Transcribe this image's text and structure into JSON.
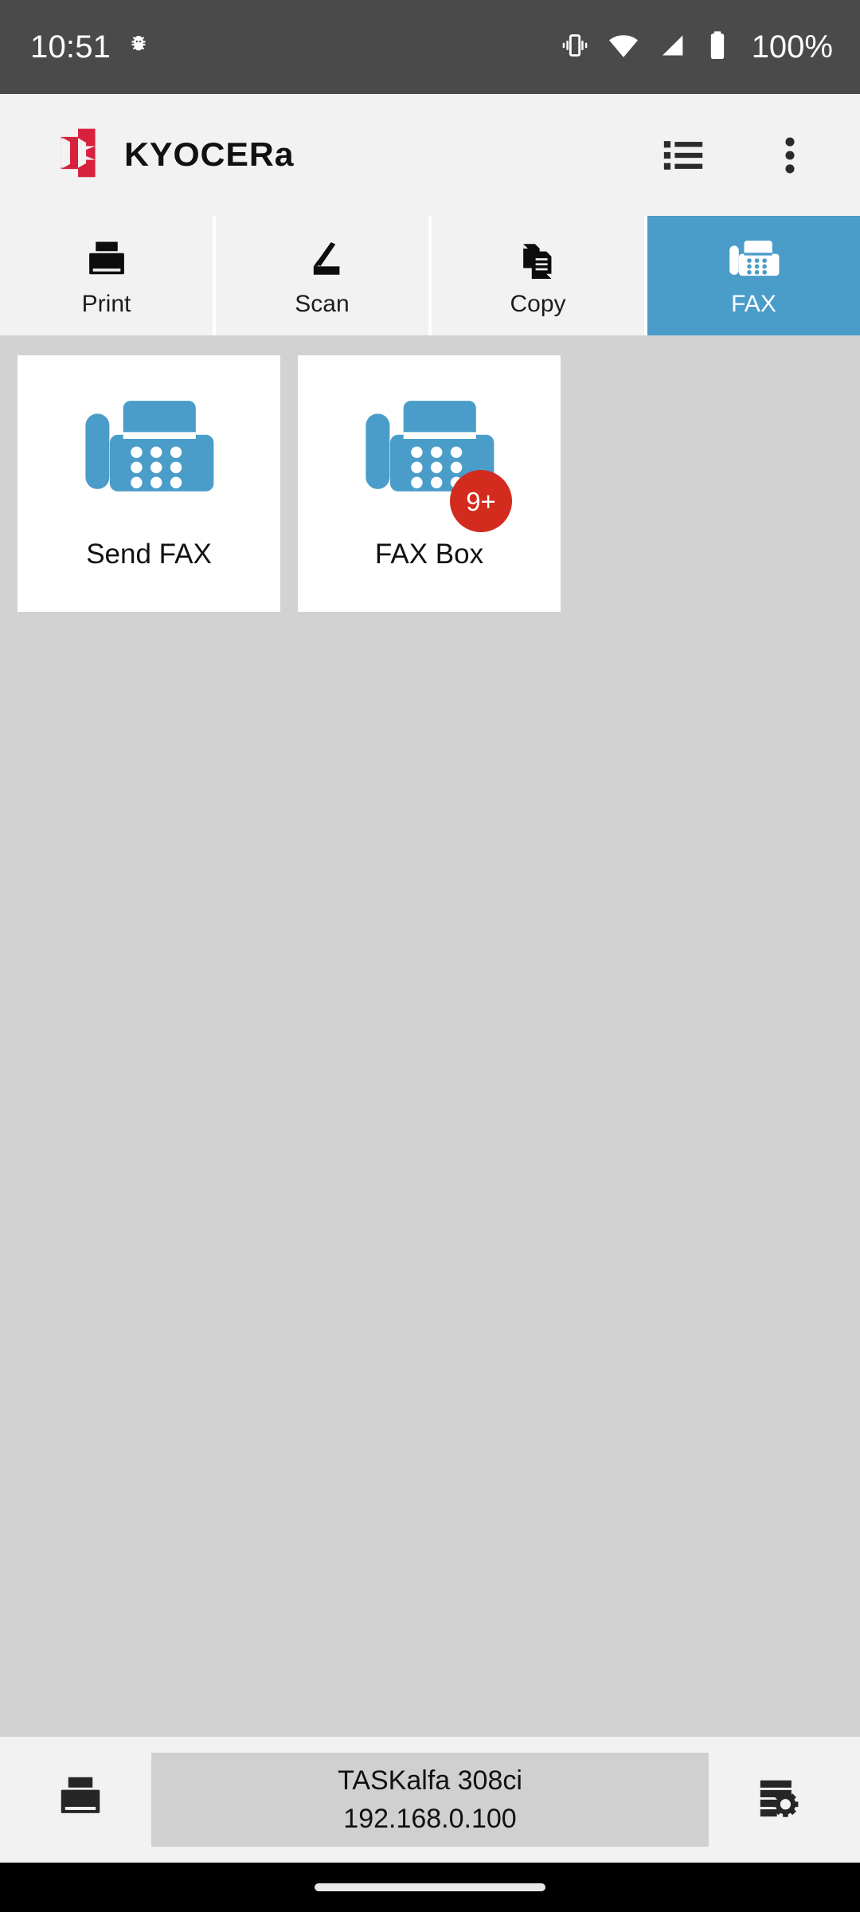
{
  "statusbar": {
    "time": "10:51",
    "battery_percent": "100%",
    "icons": [
      "bug-icon",
      "vibrate-icon",
      "wifi-icon",
      "cellular-signal-icon",
      "battery-icon"
    ]
  },
  "appbar": {
    "brand": "KYOCERA",
    "actions": [
      {
        "name": "list-view-icon",
        "label": "List"
      },
      {
        "name": "overflow-menu-icon",
        "label": "More options"
      }
    ]
  },
  "tabs": [
    {
      "label": "Print",
      "icon": "printer-icon",
      "active": false
    },
    {
      "label": "Scan",
      "icon": "scanner-icon",
      "active": false
    },
    {
      "label": "Copy",
      "icon": "copy-documents-icon",
      "active": false
    },
    {
      "label": "FAX",
      "icon": "fax-machine-icon",
      "active": true
    }
  ],
  "cards": [
    {
      "label": "Send FAX",
      "icon": "fax-machine-icon",
      "badge": ""
    },
    {
      "label": "FAX Box",
      "icon": "fax-machine-icon",
      "badge": "9+"
    }
  ],
  "bottombar": {
    "printer_icon": "printer-icon",
    "device_name": "TASKalfa 308ci",
    "device_ip": "192.168.0.100",
    "settings_icon": "device-settings-icon"
  },
  "colors": {
    "statusbar_bg": "#4a4a4a",
    "appbar_bg": "#f2f2f2",
    "accent_blue": "#4a9cc9",
    "brand_red": "#d8213c",
    "badge_red": "#d32b1e",
    "content_bg": "#d2d2d2",
    "card_bg": "#ffffff",
    "device_btn_bg": "#d0d0d0"
  }
}
